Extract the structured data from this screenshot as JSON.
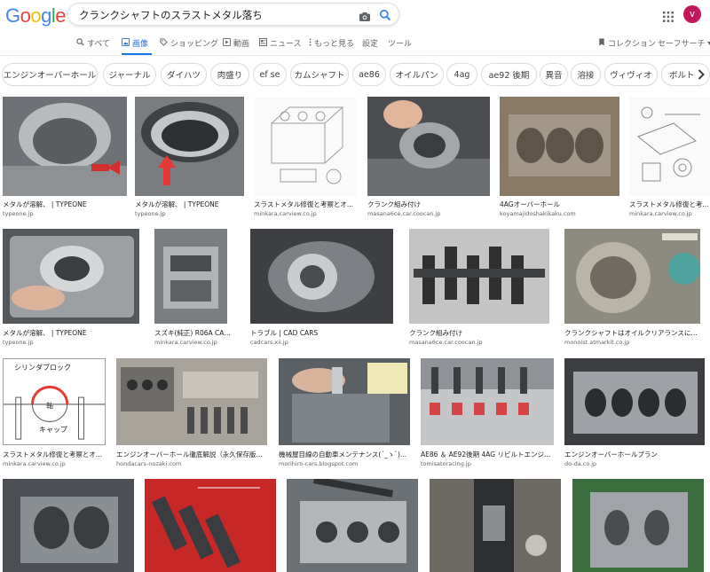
{
  "logo": {
    "letters": [
      "G",
      "o",
      "o",
      "g",
      "l",
      "e"
    ],
    "colors": [
      "#4285F4",
      "#EA4335",
      "#FBBC05",
      "#4285F4",
      "#34A853",
      "#EA4335"
    ]
  },
  "search": {
    "query": "クランクシャフトのスラストメタル落ち",
    "camera_icon": "camera-icon",
    "search_icon": "search-icon"
  },
  "account": {
    "initial": "v",
    "color": "#c2185b"
  },
  "tabs": [
    {
      "label": "すべて",
      "icon": "search-icon",
      "active": false
    },
    {
      "label": "画像",
      "icon": "image-icon",
      "active": true
    },
    {
      "label": "ショッピング",
      "icon": "tag-icon",
      "active": false
    },
    {
      "label": "動画",
      "icon": "video-icon",
      "active": false
    },
    {
      "label": "ニュース",
      "icon": "news-icon",
      "active": false
    },
    {
      "label": "もっと見る",
      "icon": "more-vert-icon",
      "active": false
    },
    {
      "label": "設定",
      "active": false
    },
    {
      "label": "ツール",
      "active": false
    }
  ],
  "right_tabs": {
    "collection": "コレクション",
    "safesearch": "セーフサーチ"
  },
  "chips": [
    "エンジンオーバーホール",
    "ジャーナル",
    "ダイハツ",
    "肉盛り",
    "ef se",
    "カムシャフト",
    "ae86",
    "オイルパン",
    "4ag",
    "ae92 後期",
    "異音",
    "溶接",
    "ヴィヴィオ",
    "ボルト"
  ],
  "results": {
    "row1": [
      {
        "caption": "メタルが溶解、 | TYPEONE",
        "source": "typeone.jp"
      },
      {
        "caption": "メタルが溶解、 | TYPEONE",
        "source": "typeone.jp"
      },
      {
        "caption": "スラストメタル修復と考察とオ...",
        "source": "minkara.carview.co.jp"
      },
      {
        "caption": "クランク組み付け",
        "source": "masana6ce.car.coocan.jp"
      },
      {
        "caption": "4AGオーバーホール",
        "source": "koyamajidoshakikaku.com"
      },
      {
        "caption": "スラストメタル修復と考...",
        "source": "minkara.carview.co.jp"
      }
    ],
    "row2": [
      {
        "caption": "メタルが溶解、 | TYPEONE",
        "source": "typeone.jp"
      },
      {
        "caption": "スズキ(純正) R06A CAD...",
        "source": "minkara.carview.co.jp"
      },
      {
        "caption": "トラブル | CAD CARS",
        "source": "cadcars.xii.jp"
      },
      {
        "caption": "クランク組み付け",
        "source": "masana6ce.car.coocan.jp"
      },
      {
        "caption": "クランクシャフトはオイルクリアランスに要...",
        "source": "monoist.atmarkit.co.jp"
      }
    ],
    "row3": [
      {
        "caption": "スラストメタル修復と考察とオ...",
        "source": "minkara.carview.co.jp",
        "diagram": {
          "top": "シリンダブロック",
          "center": "軸",
          "bottom": "キャップ"
        }
      },
      {
        "caption": "エンジンオーバーホール徹底解説（永久保存版）...",
        "source": "hondacars-nozaki.com"
      },
      {
        "caption": "機械屋目線の自動車メンテナンス(´_ゝ`)...",
        "source": "morihiro-cars.blogspot.com"
      },
      {
        "caption": "AE86 ＆ AE92後期 4AG リビルトエンジン...",
        "source": "tomisatoracing.jp"
      },
      {
        "caption": "エンジンオーバーホールプラン",
        "source": "do-da.co.jp"
      }
    ]
  },
  "next_icon": "chevron-right-icon"
}
